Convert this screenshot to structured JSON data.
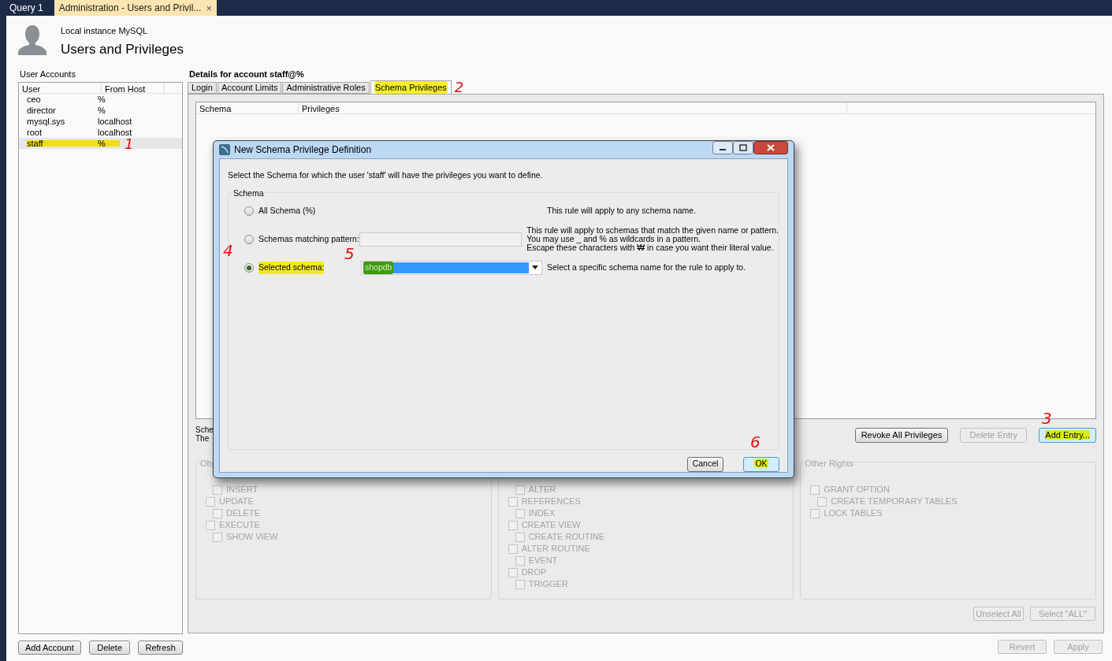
{
  "app_tabs": [
    {
      "label": "Query 1",
      "selected": false
    },
    {
      "label": "Administration - Users and Privil...",
      "selected": true,
      "close": "×"
    }
  ],
  "header": {
    "subtitle": "Local instance MySQL",
    "title": "Users and Privileges"
  },
  "user_accounts": {
    "label": "User Accounts",
    "columns": [
      "User",
      "From Host"
    ],
    "rows": [
      {
        "user": "ceo",
        "host": "%",
        "selected": false
      },
      {
        "user": "director",
        "host": "%",
        "selected": false
      },
      {
        "user": "mysql.sys",
        "host": "localhost",
        "selected": false
      },
      {
        "user": "root",
        "host": "localhost",
        "selected": false
      },
      {
        "user": "staff",
        "host": "%",
        "selected": true,
        "highlighted": true
      }
    ],
    "buttons": [
      "Add Account",
      "Delete",
      "Refresh"
    ]
  },
  "details": {
    "title": "Details for account staff@%",
    "tabs": [
      {
        "label": "Login",
        "selected": false,
        "highlighted": false
      },
      {
        "label": "Account Limits",
        "selected": false,
        "highlighted": false
      },
      {
        "label": "Administrative Roles",
        "selected": false,
        "highlighted": false
      },
      {
        "label": "Schema Privileges",
        "selected": true,
        "highlighted": true
      }
    ],
    "table_columns": [
      "Schema",
      "Privileges"
    ],
    "info_lines": [
      "Sche",
      "The"
    ],
    "buttons": [
      {
        "label": "Revoke All Privileges",
        "disabled": false,
        "focused": false,
        "highlighted": false
      },
      {
        "label": "Delete Entry",
        "disabled": true,
        "focused": false,
        "highlighted": false
      },
      {
        "label": "Add Entry...",
        "disabled": false,
        "focused": true,
        "highlighted": true
      }
    ],
    "groups": [
      {
        "title": "Obj",
        "items": [
          {
            "label": "INSERT",
            "kind": "sub",
            "checked": false
          },
          {
            "label": "UPDATE",
            "kind": "main",
            "checked": false
          },
          {
            "label": "DELETE",
            "kind": "sub",
            "checked": false
          },
          {
            "label": "EXECUTE",
            "kind": "main",
            "checked": false
          },
          {
            "label": "SHOW VIEW",
            "kind": "sub",
            "checked": false
          }
        ]
      },
      {
        "items": [
          {
            "label": "ALTER",
            "kind": "sub",
            "checked": false
          },
          {
            "label": "REFERENCES",
            "kind": "main",
            "checked": false
          },
          {
            "label": "INDEX",
            "kind": "sub",
            "checked": false
          },
          {
            "label": "CREATE VIEW",
            "kind": "main",
            "checked": false
          },
          {
            "label": "CREATE ROUTINE",
            "kind": "sub",
            "checked": false
          },
          {
            "label": "ALTER ROUTINE",
            "kind": "main",
            "checked": false
          },
          {
            "label": "EVENT",
            "kind": "sub",
            "checked": false
          },
          {
            "label": "DROP",
            "kind": "main",
            "checked": false
          },
          {
            "label": "TRIGGER",
            "kind": "sub",
            "checked": false
          }
        ]
      },
      {
        "title": "Other Rights",
        "items": [
          {
            "label": "GRANT OPTION",
            "kind": "main",
            "checked": false
          },
          {
            "label": "CREATE TEMPORARY TABLES",
            "kind": "sub",
            "checked": false
          },
          {
            "label": "LOCK TABLES",
            "kind": "main",
            "checked": false
          }
        ]
      }
    ],
    "select_buttons": [
      "Unselect All",
      "Select \"ALL\""
    ],
    "footer_buttons": [
      "Revert",
      "Apply"
    ]
  },
  "dialog": {
    "title": "New Schema Privilege Definition",
    "intro": "Select the Schema for which the user 'staff' will have the privileges you want to define.",
    "group_title": "Schema",
    "options": [
      {
        "kind": "plain",
        "label": "All Schema (%)",
        "selected": false,
        "highlighted": false,
        "hint": "This rule will apply to any schema name."
      },
      {
        "kind": "pattern",
        "label": "Schemas matching pattern:",
        "selected": false,
        "highlighted": false,
        "hint": "This rule will apply to schemas that match the given name or pattern.\nYou may use _ and % as wildcards in a pattern.\nEscape these characters with ₩ in case you want their literal value."
      },
      {
        "kind": "dropdown",
        "label": "Selected schema:",
        "selected": true,
        "highlighted": true,
        "value": "shopdb",
        "hint": "Select a specific schema name for the rule to apply to."
      }
    ],
    "buttons": [
      {
        "label": "Cancel",
        "default": false,
        "highlighted": false
      },
      {
        "label": "OK",
        "default": true,
        "highlighted": true
      }
    ]
  },
  "annotations": [
    "1",
    "2",
    "3",
    "4",
    "5",
    "6"
  ]
}
